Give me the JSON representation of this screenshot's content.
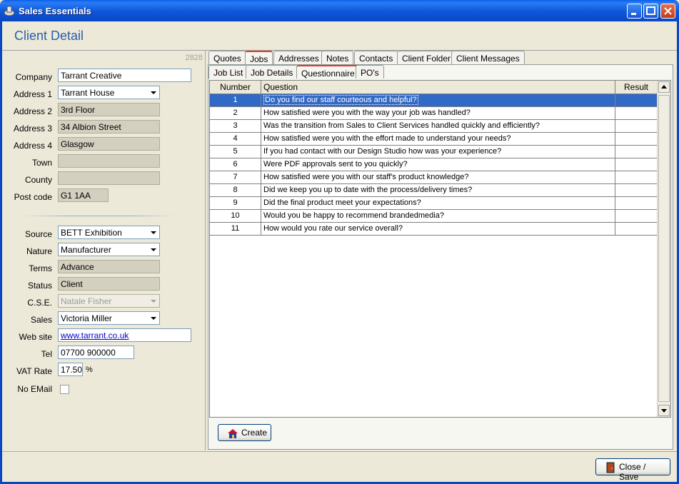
{
  "window": {
    "title": "Sales Essentials"
  },
  "page": {
    "heading": "Client Detail"
  },
  "client": {
    "record_id": "2828",
    "fields": [
      {
        "label": "Company",
        "value": "Tarrant Creative"
      },
      {
        "label": "Address 1",
        "value": "Tarrant House"
      },
      {
        "label": "Address 2",
        "value": "3rd Floor"
      },
      {
        "label": "Address 3",
        "value": "34 Albion Street"
      },
      {
        "label": "Address 4",
        "value": "Glasgow"
      },
      {
        "label": "Town",
        "value": ""
      },
      {
        "label": "County",
        "value": ""
      },
      {
        "label": "Post code",
        "value": "G1 1AA"
      }
    ],
    "details": [
      {
        "label": "Source",
        "value": "BETT Exhibition"
      },
      {
        "label": "Nature",
        "value": "Manufacturer"
      },
      {
        "label": "Terms",
        "value": "Advance"
      },
      {
        "label": "Status",
        "value": "Client"
      },
      {
        "label": "C.S.E.",
        "value": "Natale Fisher"
      },
      {
        "label": "Sales",
        "value": "Victoria Miller"
      },
      {
        "label": "Web site",
        "value": "www.tarrant.co.uk"
      },
      {
        "label": "Tel",
        "value": "07700 900000"
      },
      {
        "label": "VAT Rate",
        "value": "17.50",
        "suffix": "%"
      },
      {
        "label": "No EMail",
        "value": ""
      }
    ]
  },
  "tabs": [
    "Quotes",
    "Jobs",
    "Addresses",
    "Notes",
    "Contacts",
    "Client Folder",
    "Client Messages"
  ],
  "subtabs": [
    "Job List",
    "Job Details",
    "Questionnaire",
    "PO's"
  ],
  "grid": {
    "headers": [
      "Number",
      "Question",
      "Result"
    ],
    "rows": [
      {
        "number": "1",
        "question": "Do you find our staff courteous and helpful?",
        "result": ""
      },
      {
        "number": "2",
        "question": "How satisfied were you with the way your job was handled?",
        "result": ""
      },
      {
        "number": "3",
        "question": "Was the transition from Sales to Client Services handled quickly and efficiently?",
        "result": ""
      },
      {
        "number": "4",
        "question": "How satisfied were you with the effort made to understand your needs?",
        "result": ""
      },
      {
        "number": "5",
        "question": "If you had contact with our Design Studio how was your experience?",
        "result": ""
      },
      {
        "number": "6",
        "question": "Were PDF approvals sent to you quickly?",
        "result": ""
      },
      {
        "number": "7",
        "question": "How satisfied were you with our staff's product knowledge?",
        "result": ""
      },
      {
        "number": "8",
        "question": "Did we keep you up to date with the process/delivery times?",
        "result": ""
      },
      {
        "number": "9",
        "question": "Did the final product meet your expectations?",
        "result": ""
      },
      {
        "number": "10",
        "question": "Would you be happy to recommend brandedmedia?",
        "result": ""
      },
      {
        "number": "11",
        "question": "How would you rate our service overall?",
        "result": ""
      }
    ]
  },
  "buttons": {
    "create": "Create",
    "close_save": "Close / Save"
  },
  "icons": {
    "app": "app-icon",
    "create": "house-icon",
    "close": "exit-door-icon"
  },
  "colors": {
    "accent": "#2C5EA8",
    "selection": "#3169C6",
    "active_tab": "#E03A2A"
  }
}
